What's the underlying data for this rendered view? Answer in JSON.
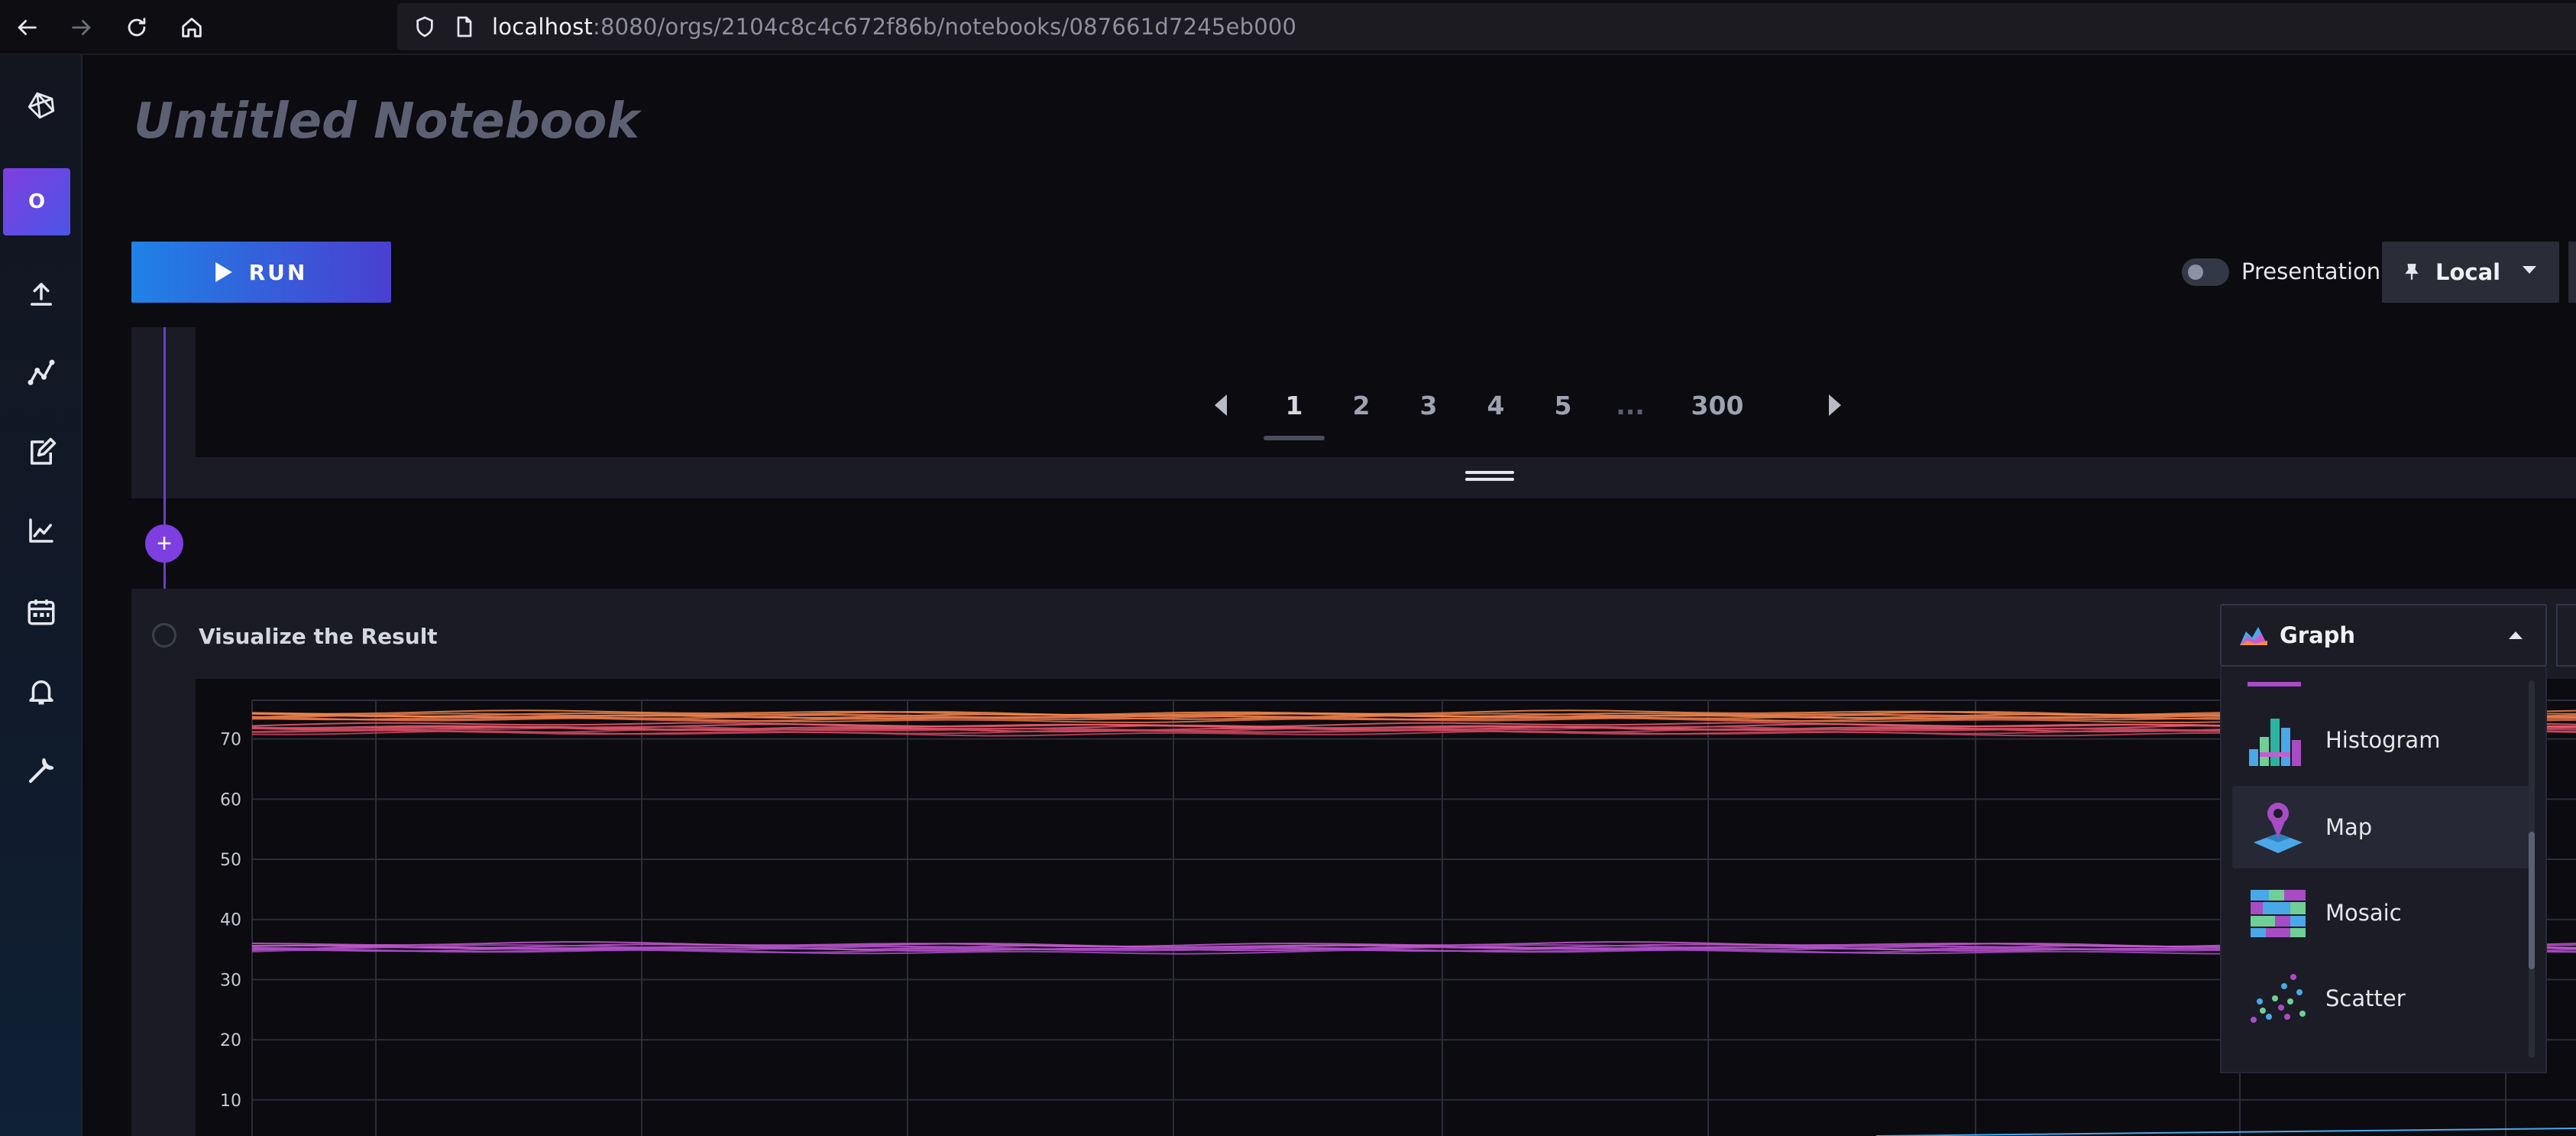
{
  "browser": {
    "url_host": "localhost",
    "url_rest": ":8080/orgs/2104c8c4c672f86b/notebooks/087661d7245eb000"
  },
  "sidebar": {
    "org_initial": "O",
    "icons": [
      "influx-logo-icon",
      "upload-icon",
      "data-explorer-icon",
      "notebook-icon",
      "dashboard-icon",
      "calendar-icon",
      "bell-icon",
      "wrench-icon"
    ]
  },
  "notebook": {
    "title": "Untitled Notebook",
    "run_label": "RUN",
    "presentation_label": "Presentation",
    "presentation_on": false,
    "time_zone_label": "Local"
  },
  "pagination": {
    "pages": [
      "1",
      "2",
      "3",
      "4",
      "5",
      "...",
      "300"
    ],
    "active": "1"
  },
  "vis_cell": {
    "title": "Visualize the Result",
    "selected_type": "Graph",
    "menu_items": [
      "Histogram",
      "Map",
      "Mosaic",
      "Scatter"
    ],
    "hovered_item": "Map"
  },
  "chart_data": {
    "type": "line",
    "y_ticks": [
      "70",
      "60",
      "50",
      "40",
      "30",
      "20",
      "10"
    ],
    "y_tick_values": [
      70,
      60,
      50,
      40,
      30,
      20,
      10
    ],
    "ylim": [
      4,
      80
    ],
    "series_bands": [
      {
        "level": 74,
        "color": "#f4894c"
      },
      {
        "level": 73.5,
        "color": "#e8764a"
      },
      {
        "level": 72,
        "color": "#ef5d6e"
      },
      {
        "level": 71.3,
        "color": "#c9475e"
      },
      {
        "level": 35.5,
        "color": "#c75bd1"
      },
      {
        "level": 35,
        "color": "#a84cc4"
      }
    ],
    "grid": true
  }
}
